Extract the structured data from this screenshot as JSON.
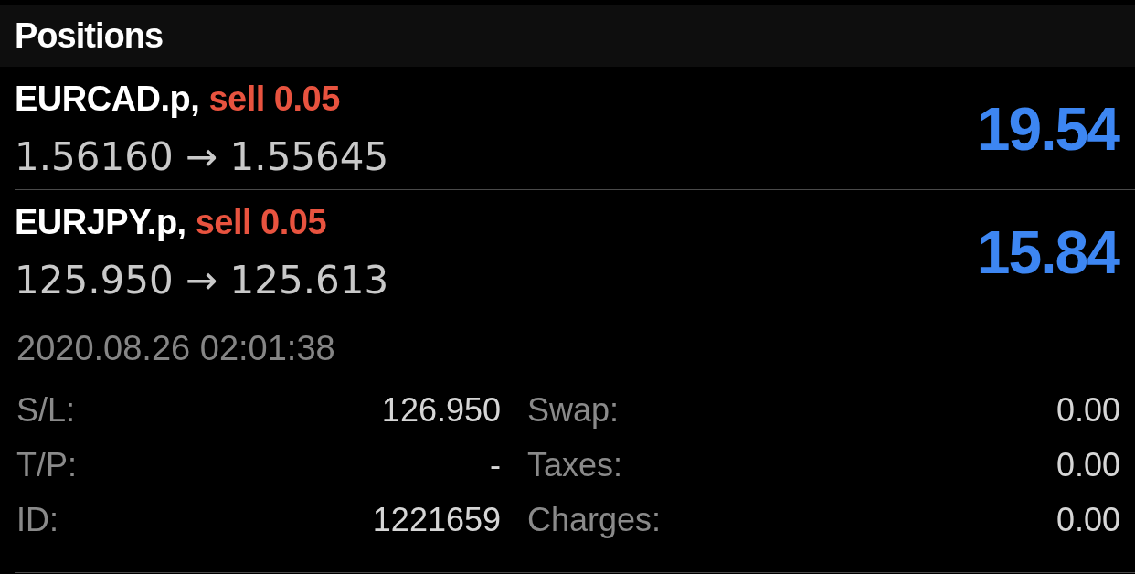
{
  "header": {
    "title": "Positions"
  },
  "positions": [
    {
      "symbol": "EURCAD.p,",
      "order": "sell 0.05",
      "prices": "1.56160 → 1.55645",
      "profit": "19.54"
    },
    {
      "symbol": "EURJPY.p,",
      "order": "sell 0.05",
      "prices": "125.950 → 125.613",
      "profit": "15.84",
      "details": {
        "time": "2020.08.26 02:01:38",
        "columns": [
          [
            {
              "label": "S/L:",
              "value": "126.950"
            },
            {
              "label": "T/P:",
              "value": "-"
            },
            {
              "label": "ID:",
              "value": "1221659"
            }
          ],
          [
            {
              "label": "Swap:",
              "value": "0.00"
            },
            {
              "label": "Taxes:",
              "value": "0.00"
            },
            {
              "label": "Charges:",
              "value": "0.00"
            }
          ]
        ]
      }
    }
  ]
}
